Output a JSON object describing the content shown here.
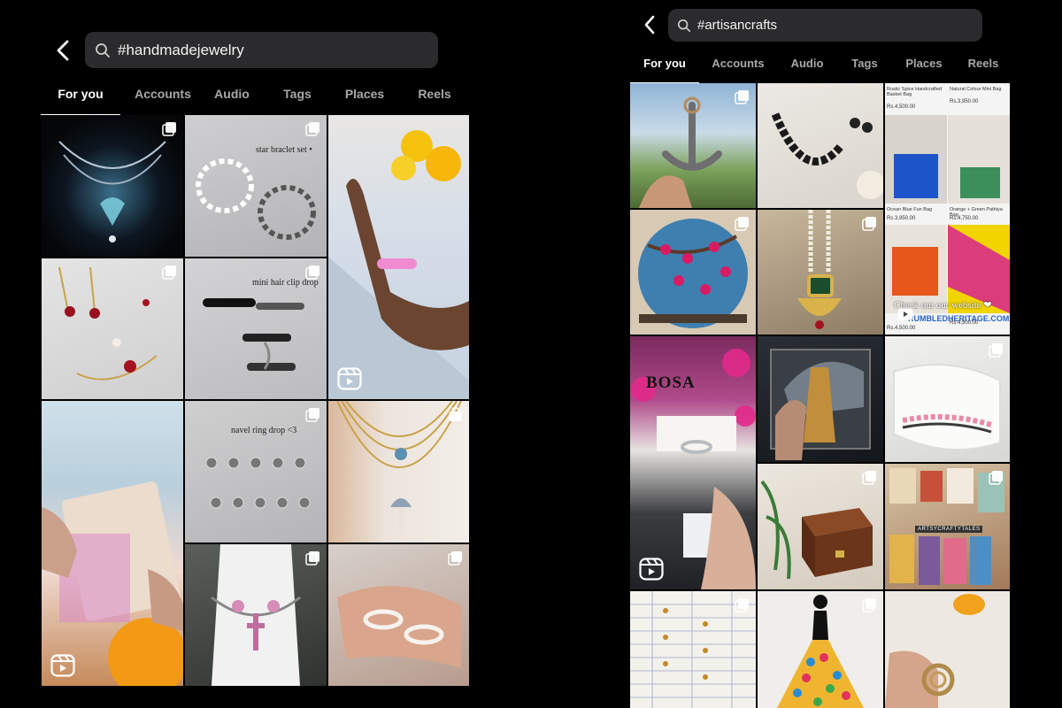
{
  "left": {
    "search": {
      "query": "#handmadejewelry"
    },
    "tabs": [
      "For you",
      "Accounts",
      "Audio",
      "Tags",
      "Places",
      "Reels"
    ],
    "active_tab": "For you",
    "tiles": [
      {
        "name": "post-crystal-heart-necklace",
        "badge": "carousel"
      },
      {
        "name": "post-star-bracelet-set",
        "badge": "carousel",
        "overlay": "star braclet set •"
      },
      {
        "name": "post-pink-bead-bracelet-reel",
        "badge": "none",
        "reel": true
      },
      {
        "name": "post-red-heart-earrings",
        "badge": "carousel"
      },
      {
        "name": "post-mini-hair-clip-drop",
        "badge": "carousel",
        "overlay": "mini hair clip drop"
      },
      {
        "name": "post-holographic-packaging-reel",
        "badge": "none",
        "reel": true
      },
      {
        "name": "post-navel-ring-drop",
        "badge": "carousel",
        "overlay": "navel ring drop <3"
      },
      {
        "name": "post-layered-gold-necklaces",
        "badge": "shop"
      },
      {
        "name": "post-pink-cross-choker",
        "badge": "carousel"
      },
      {
        "name": "post-beaded-rings",
        "badge": "carousel"
      }
    ]
  },
  "right": {
    "search": {
      "query": "#artisancrafts"
    },
    "tabs": [
      "For you",
      "Accounts",
      "Audio",
      "Tags",
      "Places",
      "Reels"
    ],
    "active_tab": "For you",
    "tiles": [
      {
        "name": "post-anchor-carving",
        "badge": "carousel"
      },
      {
        "name": "post-black-beaded-necklace",
        "badge": "none"
      },
      {
        "name": "post-handwoven-bags-catalog",
        "badge": "none",
        "caption": "Check out our website ❤",
        "site": "RUMBLEDHERITAGE.COM",
        "products": [
          {
            "title": "Rustic Spice Handcrafted Basket Bag",
            "price": "Rs.4,500.00"
          },
          {
            "title": "Natural Colour Mini Bag",
            "price": "Rs.3,950.00"
          },
          {
            "title": "Ocean Blue Fun Bag",
            "price": "Rs.3,950.00"
          },
          {
            "title": "Orange + Green Pathiya Bag",
            "price": "Rs.4,750.00"
          }
        ],
        "bottom_prices": [
          "Rs.4,500.00",
          "Rs.4,500.00"
        ]
      },
      {
        "name": "post-painted-cherry-blossom-plate",
        "badge": "carousel"
      },
      {
        "name": "post-kundan-pendant",
        "badge": "carousel"
      },
      {
        "name": "post-bosa-silver-ring-reel",
        "badge": "none",
        "reel": true,
        "logo": "BOSA"
      },
      {
        "name": "post-brass-tool-lace",
        "badge": "none"
      },
      {
        "name": "post-crochet-pink-edge",
        "badge": "carousel"
      },
      {
        "name": "post-wooden-box",
        "badge": "carousel"
      },
      {
        "name": "post-artsy-crafty-tales-collage",
        "badge": "carousel",
        "overlay": "ARTSYCRAFTYTALES"
      },
      {
        "name": "post-handwritten-chart",
        "badge": "carousel"
      },
      {
        "name": "post-quilled-dress",
        "badge": "carousel"
      },
      {
        "name": "post-jute-coaster",
        "badge": "none"
      }
    ]
  }
}
